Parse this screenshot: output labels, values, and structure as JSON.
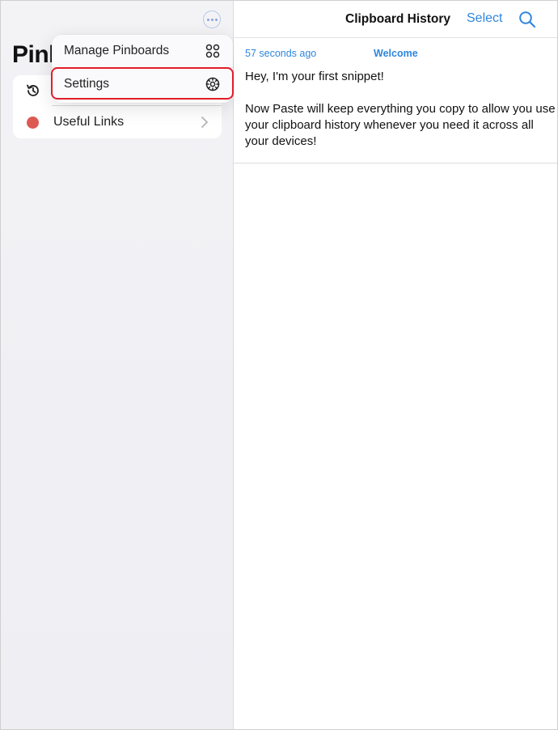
{
  "sidebar": {
    "title": "Pinl",
    "pinboards": [
      {
        "icon": "history-icon"
      },
      {
        "label": "Useful Links",
        "color": "#dd5a52"
      }
    ]
  },
  "menu": {
    "items": [
      {
        "label": "Manage Pinboards",
        "icon": "grid-icon"
      },
      {
        "label": "Settings",
        "icon": "gear-icon",
        "highlighted": true
      }
    ],
    "highlight_color": "#e11d2a"
  },
  "main": {
    "title": "Clipboard History",
    "select_label": "Select",
    "snippet": {
      "time": "57 seconds ago",
      "title": "Welcome",
      "line1": "Hey, I'm your first snippet!",
      "body": "Now Paste will keep everything you copy to allow you use your clipboard history whenever you need it across all your devices!"
    }
  },
  "accent_color": "#2f86de"
}
